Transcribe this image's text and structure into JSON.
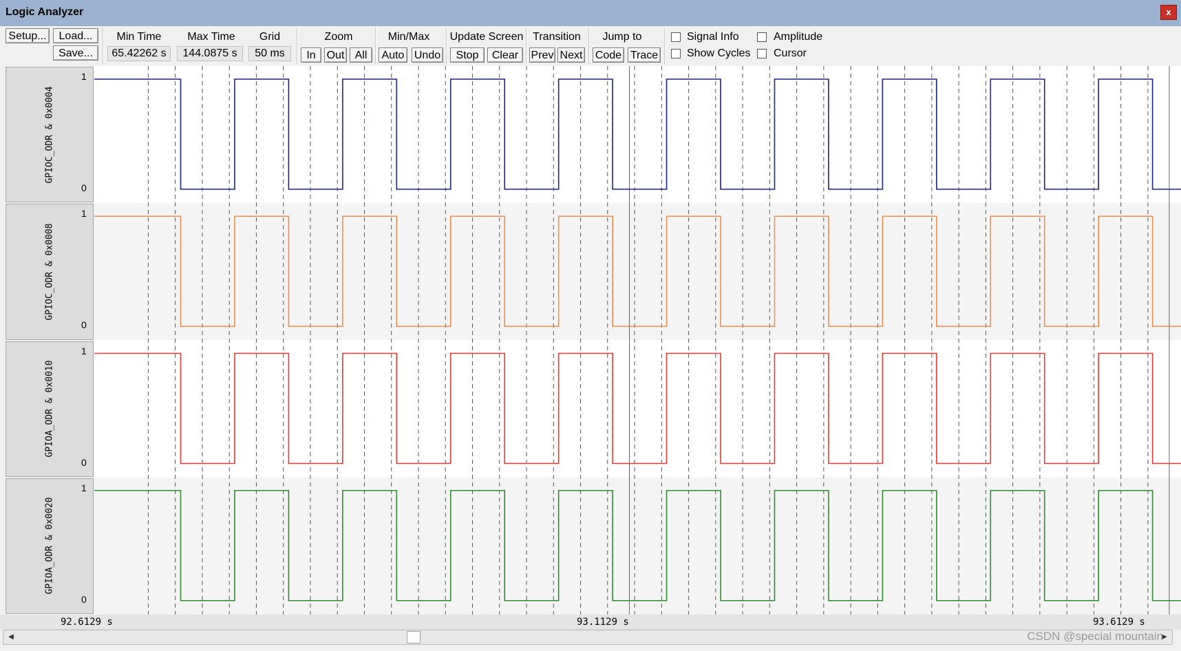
{
  "window": {
    "title": "Logic Analyzer",
    "close_label": "x"
  },
  "toolbar": {
    "setup": "Setup...",
    "load": "Load...",
    "save": "Save...",
    "min_time_label": "Min Time",
    "min_time_value": "65.42262 s",
    "max_time_label": "Max Time",
    "max_time_value": "144.0875 s",
    "grid_label": "Grid",
    "grid_value": "50 ms",
    "zoom_label": "Zoom",
    "zoom_in": "In",
    "zoom_out": "Out",
    "zoom_all": "All",
    "minmax_label": "Min/Max",
    "auto": "Auto",
    "undo": "Undo",
    "update_label": "Update Screen",
    "stop": "Stop",
    "clear": "Clear",
    "transition_label": "Transition",
    "prev": "Prev",
    "next": "Next",
    "jumpto_label": "Jump to",
    "code": "Code",
    "trace": "Trace",
    "signal_info": "Signal Info",
    "show_cycles": "Show Cycles",
    "amplitude": "Amplitude",
    "cursor": "Cursor"
  },
  "signals": [
    {
      "name": "GPIOC_ODR & 0x0004",
      "color": "#1a237e",
      "high": "1",
      "low": "0"
    },
    {
      "name": "GPIOC_ODR & 0x0008",
      "color": "#f28c4a",
      "high": "1",
      "low": "0"
    },
    {
      "name": "GPIOA_ODR & 0x0010",
      "color": "#e53935",
      "high": "1",
      "low": "0"
    },
    {
      "name": "GPIOA_ODR & 0x0020",
      "color": "#2e8b2e",
      "high": "1",
      "low": "0"
    }
  ],
  "waveform": {
    "start_level": 1,
    "transition_times_s": [
      92.6929,
      92.7429,
      92.7929,
      92.8429,
      92.8929,
      92.9429,
      92.9929,
      93.0429,
      93.0929,
      93.1429,
      93.1929,
      93.2429,
      93.2929,
      93.3429,
      93.3929,
      93.4429,
      93.4929,
      93.5429,
      93.5929
    ]
  },
  "time_axis": {
    "left": "92.6129 s",
    "center": "93.1129 s",
    "right": "93.6129 s"
  },
  "watermark": "CSDN @special mountain"
}
